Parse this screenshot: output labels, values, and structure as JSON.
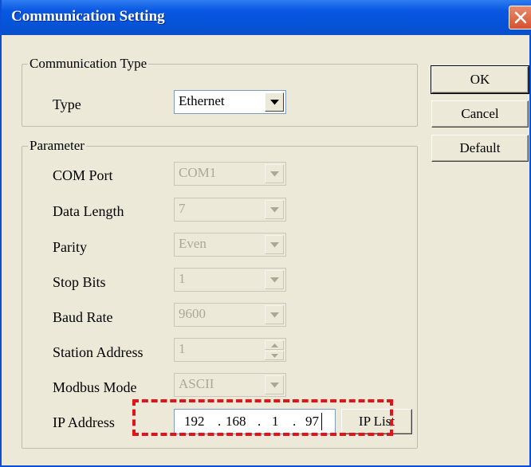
{
  "window": {
    "title": "Communication Setting",
    "colors": {
      "titlebar": "#0553d8",
      "face": "#ece9d8",
      "disabled_text": "#aca899",
      "highlight": "#e0141b"
    }
  },
  "buttons": {
    "ok": "OK",
    "cancel": "Cancel",
    "default": "Default",
    "ip_list": "IP List"
  },
  "communication_type": {
    "title": "Communication Type",
    "type_label": "Type",
    "type_value": "Ethernet"
  },
  "parameter": {
    "title": "Parameter",
    "com_port": {
      "label": "COM Port",
      "value": "COM1"
    },
    "data_length": {
      "label": "Data Length",
      "value": "7"
    },
    "parity": {
      "label": "Parity",
      "value": "Even"
    },
    "stop_bits": {
      "label": "Stop Bits",
      "value": "1"
    },
    "baud_rate": {
      "label": "Baud Rate",
      "value": "9600"
    },
    "station_address": {
      "label": "Station Address",
      "value": "1"
    },
    "modbus_mode": {
      "label": "Modbus Mode",
      "value": "ASCII"
    },
    "ip_address": {
      "label": "IP Address",
      "octets": [
        "192",
        "168",
        "1",
        "97"
      ],
      "separator": "."
    }
  },
  "icons": {
    "close": "close-icon",
    "dropdown": "chevron-down-icon",
    "spin_up": "chevron-up-icon",
    "spin_down": "chevron-down-icon"
  }
}
